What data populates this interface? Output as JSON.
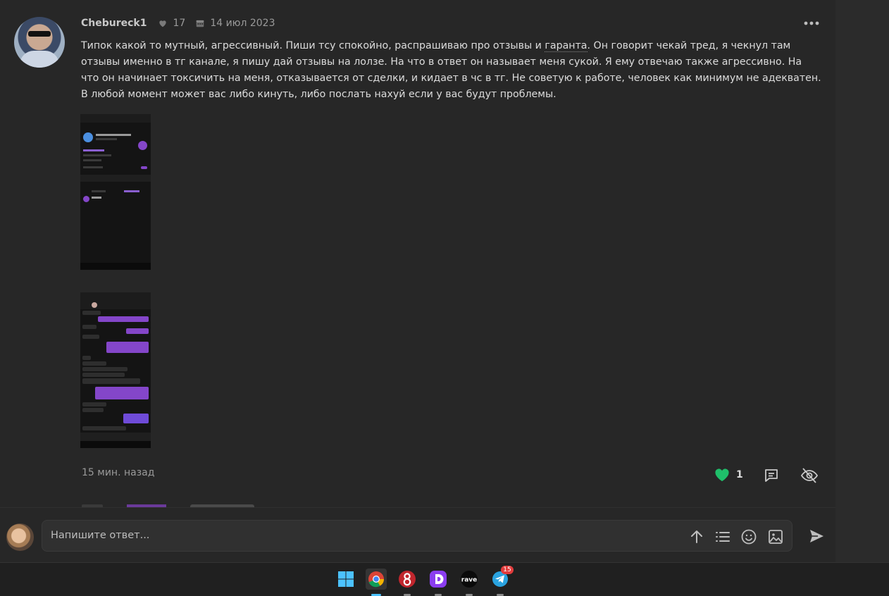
{
  "post": {
    "author": "Chebureck1",
    "likes_total": "17",
    "join_date": "14 июл 2023",
    "text_before_link": "Типок какой то мутный, агрессивный. Пиши тсу спокойно, распрашиваю про отзывы и ",
    "link_text": "гаранта",
    "text_after_link": ". Он говорит чекай тред, я чекнул там отзывы именно в тг канале, я пишу дай отзывы на лолзе. На что в ответ он называет меня сукой. Я ему отвечаю также агрессивно. На что он начинает токсичить на меня, отказывается от сделки, и кидает в чс в тг. Не советую к работе, человек как минимум не адекватен. В любой момент может вас либо кинуть, либо послать нахуй если у вас будут проблемы.",
    "time_ago": "15 мин. назад",
    "reaction_count": "1",
    "colors": {
      "heart": "#1fbf6a",
      "accent_purple": "#8446c9"
    }
  },
  "composer": {
    "placeholder": "Напишите ответ..."
  },
  "taskbar": {
    "items": [
      {
        "name": "windows-start-icon"
      },
      {
        "name": "chrome-icon",
        "active": true
      },
      {
        "name": "app-red-icon"
      },
      {
        "name": "app-d-icon"
      },
      {
        "name": "rave-icon",
        "label": "rave"
      },
      {
        "name": "telegram-icon",
        "badge": "15"
      }
    ]
  }
}
